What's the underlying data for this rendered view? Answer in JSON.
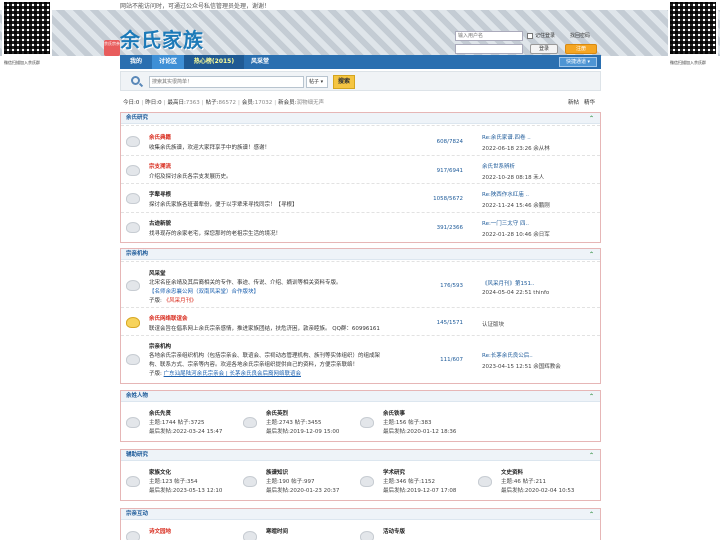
{
  "notice": "网站不能访问时，可通过公众号私信管理员处理，谢谢！",
  "header": {
    "logo": "余氏家族",
    "logo_tag": "余氏宗亲",
    "qr_caption": "微信扫描加入余氏群",
    "login": {
      "username_placeholder": "输入用户名",
      "remember": "记住登录",
      "find_password": "找回密码",
      "login_btn": "登录",
      "register_btn": "注册"
    }
  },
  "nav": {
    "items": [
      "我的",
      "讨论区",
      "热心榜(2015)",
      "风采堂"
    ],
    "quick": "快捷通道"
  },
  "search": {
    "placeholder": "搜索其实很简单！",
    "type": "帖子",
    "button": "搜索"
  },
  "stats": {
    "today_label": "今日:",
    "today": "0",
    "yesterday_label": "昨日:",
    "yesterday": "0",
    "max_label": "最高日:",
    "max": "7363",
    "posts_label": "帖子:",
    "posts": "86572",
    "members_label": "会员:",
    "members": "17032",
    "newest_label": "新会员:",
    "newest": "润物细无声",
    "links": [
      "新帖",
      "精华"
    ]
  },
  "sections": [
    {
      "title": "余氏研究",
      "forums": [
        {
          "name": "余氏典籍",
          "desc": "收集余氏族谱，欢迎大家拜享手中的族谱！感谢！",
          "count": "608/7824",
          "last_title": "Re:余氏家谱.四卷 ..",
          "last_meta": "2022-06-18 23:26 余从林"
        },
        {
          "name": "宗支溯流",
          "desc": "介绍及探讨余氏各宗支发展历史。",
          "count": "917/6941",
          "last_title": "余氏世系辨析",
          "last_meta": "2022-10-28 08:18 禾人"
        },
        {
          "name": "字辈寻根",
          "desc": "探讨余氏家族各班谱辈份，便于以字辈来寻找同宗！【寻根】",
          "count": "1058/5672",
          "last_title": "Re:陕西作水红庙 ..",
          "last_meta": "2022-11-24 15:46 余鹏刚"
        },
        {
          "name": "古迹新貌",
          "desc": "找寻现存的余家老宅，探您那时的老祖宗生活的境况！",
          "count": "391/2366",
          "last_title": "Re:一门三太守 四..",
          "last_meta": "2022-01-28 10:46 余日军"
        }
      ]
    },
    {
      "title": "宗亲机构",
      "forums": [
        {
          "name": "风采堂",
          "desc": "北宋名臣余靖及其后裔相关的专作、事迹、传说、介绍、嫡训等相关资料专版。",
          "desc2": "【名师余忠襄公网（双南风采堂）合作版块】",
          "sub": "子版:",
          "sub_link": "《风采月刊》",
          "count": "176/593",
          "last_title": "《风采月刊》第151..",
          "last_meta": "2024-05-04 22:51 thinfo"
        },
        {
          "name": "余氏网络联谊会",
          "desc": "联谊会旨在倡系网上余氏宗亲感情，推进家族团结，扶危济困，敦亲睦族。 QQ群：60996161",
          "count": "145/1571",
          "last_title": "认证版块",
          "last_meta": ""
        },
        {
          "name": "宗亲机构",
          "desc": "各地余氏宗亲组织机构（包括宗亲会、联谊会、宗祠动态管理机构、族刊等实体组织）的组成架",
          "desc2": "构、联系方式、宗亲等内容。欢迎各地余氏宗亲组织提供自己的资料，方便宗亲联络！",
          "sub": "子版:",
          "sub_link": "广东汕尾陆河余氏宗亲会 | 长茅余氏良会后裔网络联谊会",
          "count": "111/607",
          "last_title": "Re:长茅余氏良公后..",
          "last_meta": "2023-04-15 12:51 余国辉教会"
        }
      ]
    },
    {
      "title": "余姓人物",
      "cells": [
        {
          "name": "余氏先贤",
          "stat": "主题:1744  帖子:3725",
          "last": "最后发帖:2022-03-24 15:47"
        },
        {
          "name": "余氏英烈",
          "stat": "主题:2743  帖子:3455",
          "last": "最后发帖:2019-12-09 15:00"
        },
        {
          "name": "余氏铁事",
          "stat": "主题:156  帖子:383",
          "last": "最后发帖:2020-01-12 18:36"
        }
      ]
    },
    {
      "title": "辅助研究",
      "cells": [
        {
          "name": "家族文化",
          "stat": "主题:123  帖子:354",
          "last": "最后发帖:2023-05-13 12:10"
        },
        {
          "name": "族谱知识",
          "stat": "主题:190  帖子:997",
          "last": "最后发帖:2020-01-23 20:37"
        },
        {
          "name": "学术研究",
          "stat": "主题:346  帖子:1152",
          "last": "最后发帖:2019-12-07 17:08"
        },
        {
          "name": "文史资料",
          "stat": "主题:46  帖子:211",
          "last": "最后发帖:2020-02-04 10:53"
        }
      ]
    },
    {
      "title": "宗亲互动",
      "cells": [
        {
          "name": "诗文园地",
          "stat": "",
          "last": ""
        },
        {
          "name": "寒暄时间",
          "stat": "",
          "last": ""
        },
        {
          "name": "活动专版",
          "stat": "",
          "last": ""
        }
      ]
    }
  ]
}
